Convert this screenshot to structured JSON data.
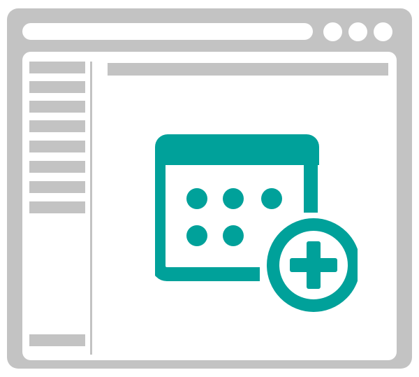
{
  "window": {
    "controls": [
      "window-control",
      "window-control",
      "window-control"
    ]
  },
  "sidebar": {
    "items": [
      "",
      "",
      "",
      "",
      "",
      "",
      "",
      ""
    ],
    "footer_item": ""
  },
  "main": {
    "icon": "calendar-add-icon"
  },
  "colors": {
    "frame": "#c3c3c3",
    "accent": "#00a19a",
    "background": "#ffffff"
  }
}
